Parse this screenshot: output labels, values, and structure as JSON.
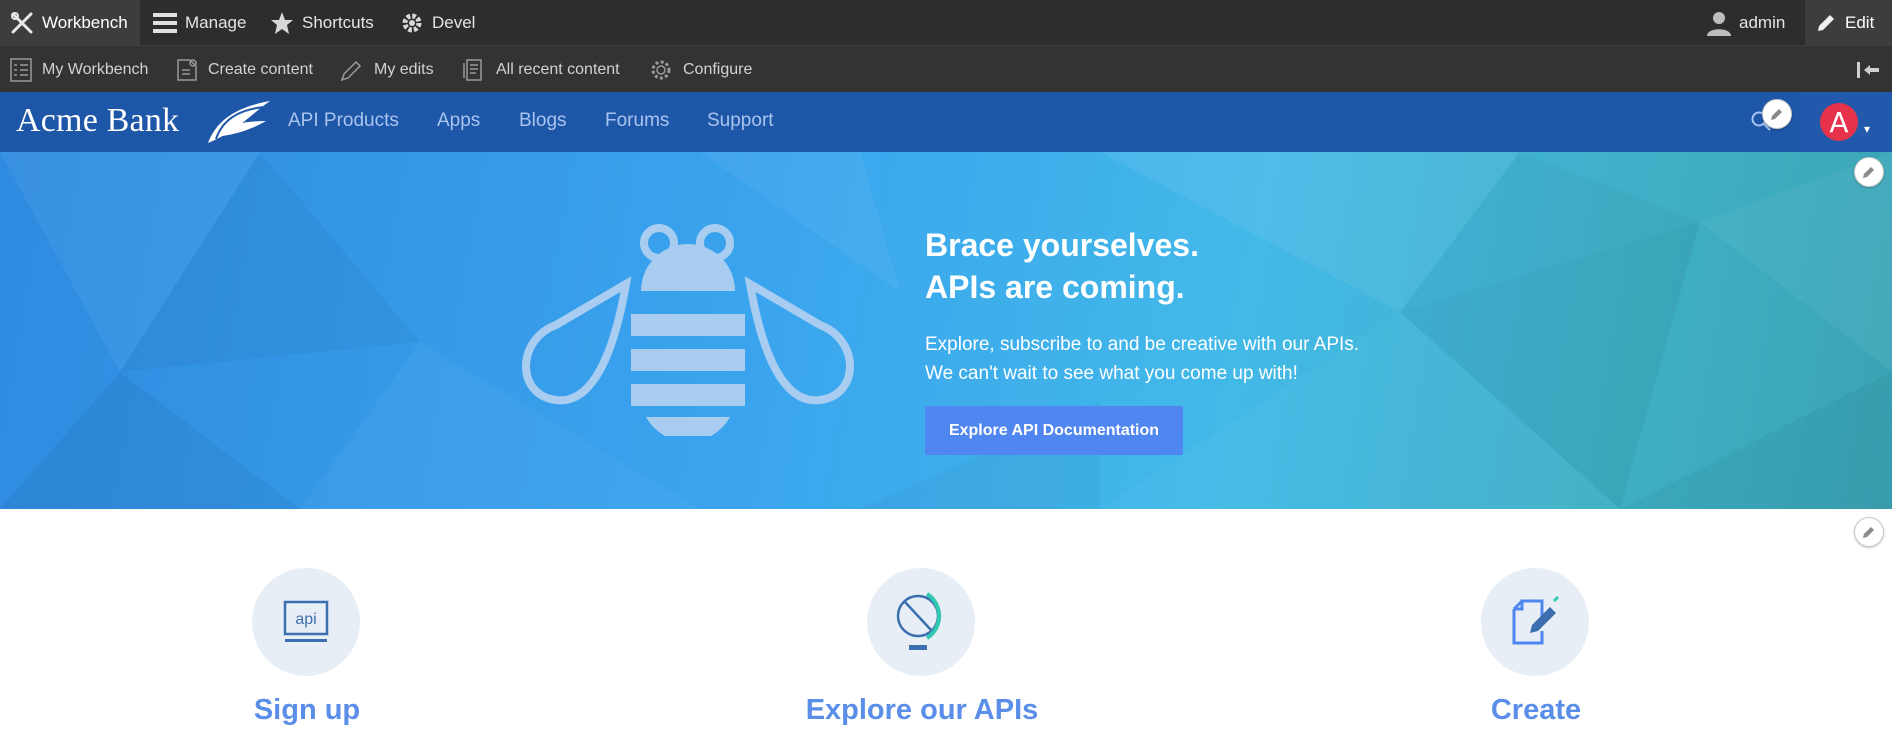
{
  "toolbar": {
    "items": [
      {
        "label": "Workbench",
        "icon": "tools-icon"
      },
      {
        "label": "Manage",
        "icon": "menu-icon"
      },
      {
        "label": "Shortcuts",
        "icon": "star-icon"
      },
      {
        "label": "Devel",
        "icon": "gear-icon"
      }
    ],
    "user_label": "admin",
    "edit_label": "Edit"
  },
  "tray": {
    "items": [
      {
        "label": "My Workbench",
        "icon": "checklist-icon"
      },
      {
        "label": "Create content",
        "icon": "document-add-icon"
      },
      {
        "label": "My edits",
        "icon": "pencil-icon"
      },
      {
        "label": "All recent content",
        "icon": "documents-icon"
      },
      {
        "label": "Configure",
        "icon": "cog-icon"
      }
    ]
  },
  "header": {
    "brand": "Acme Bank",
    "nav": [
      "API Products",
      "Apps",
      "Blogs",
      "Forums",
      "Support"
    ],
    "avatar_letter": "A",
    "caret": "▾"
  },
  "hero": {
    "title_line1": "Brace yourselves.",
    "title_line2": "APIs are coming.",
    "text_line1": "Explore, subscribe to and be creative with our APIs.",
    "text_line2": "We can't wait to see what you come up with!",
    "button_label": "Explore API Documentation"
  },
  "features": [
    {
      "title": "Sign up",
      "icon": "api-icon",
      "icon_text": "api"
    },
    {
      "title": "Explore our APIs",
      "icon": "globe-icon"
    },
    {
      "title": "Create",
      "icon": "document-edit-icon"
    }
  ],
  "colors": {
    "toolbar_bg": "#2d2d2d",
    "header_bg": "#1e56a8",
    "accent": "#4f86f0",
    "avatar": "#e6334b",
    "feature_title": "#5a8ee8"
  }
}
